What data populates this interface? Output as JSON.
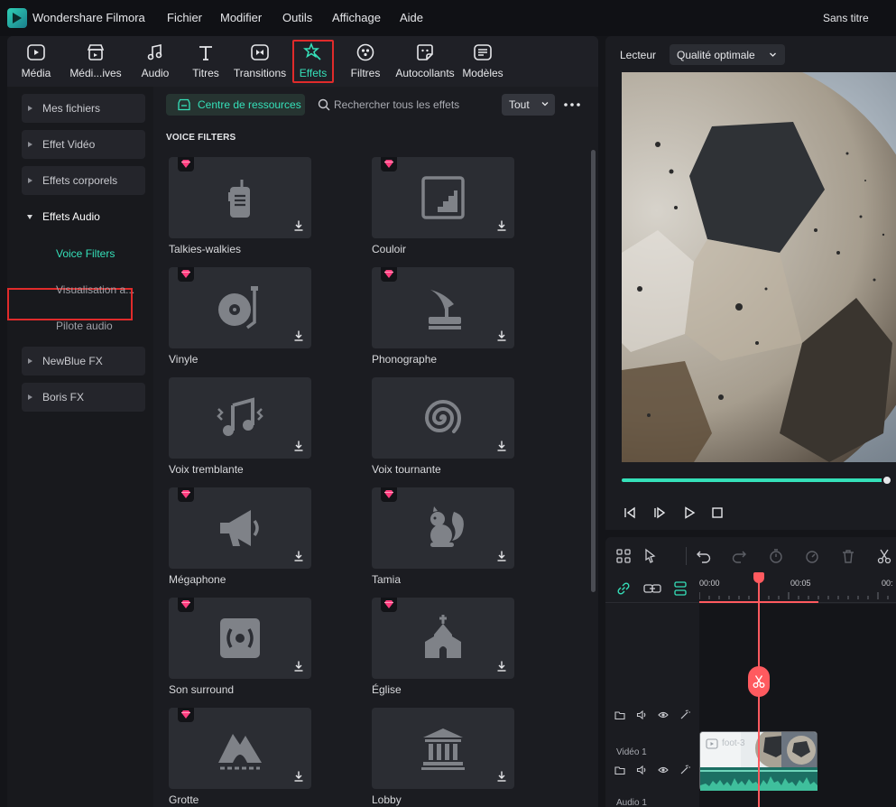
{
  "app": {
    "name": "Wondershare Filmora",
    "doc_title": "Sans titre"
  },
  "menu": [
    "Fichier",
    "Modifier",
    "Outils",
    "Affichage",
    "Aide"
  ],
  "toolbar": {
    "items": [
      {
        "label": "Média",
        "icon": "media-icon"
      },
      {
        "label": "Médi...ives",
        "icon": "stock-media-icon"
      },
      {
        "label": "Audio",
        "icon": "music-note-icon"
      },
      {
        "label": "Titres",
        "icon": "text-icon"
      },
      {
        "label": "Transitions",
        "icon": "transition-icon"
      },
      {
        "label": "Effets",
        "icon": "effects-star-icon",
        "active": true
      },
      {
        "label": "Filtres",
        "icon": "filter-icon"
      },
      {
        "label": "Autocollants",
        "icon": "sticker-icon"
      },
      {
        "label": "Modèles",
        "icon": "template-icon"
      }
    ]
  },
  "sidebar": {
    "categories": [
      {
        "label": "Mes fichiers",
        "expanded": false
      },
      {
        "label": "Effet Vidéo",
        "expanded": false
      },
      {
        "label": "Effets corporels",
        "expanded": false
      },
      {
        "label": "Effets Audio",
        "expanded": true
      },
      {
        "label": "NewBlue FX",
        "expanded": false
      },
      {
        "label": "Boris FX",
        "expanded": false
      }
    ],
    "subitems": [
      {
        "label": "Voice Filters",
        "selected": true
      },
      {
        "label": "Visualisation a...",
        "selected": false
      },
      {
        "label": "Pilote audio",
        "selected": false
      }
    ]
  },
  "content": {
    "resource_button": "Centre de ressources",
    "search_placeholder": "Rechercher tous les effets",
    "filter_value": "Tout",
    "section_title": "VOICE FILTERS",
    "effects": [
      {
        "label": "Talkies-walkies",
        "icon": "walkie-talkie-icon",
        "premium": true
      },
      {
        "label": "Couloir",
        "icon": "stairs-icon",
        "premium": true
      },
      {
        "label": "Vinyle",
        "icon": "turntable-icon",
        "premium": true
      },
      {
        "label": "Phonographe",
        "icon": "phonograph-icon",
        "premium": true
      },
      {
        "label": "Voix tremblante",
        "icon": "trembling-music-icon",
        "premium": false
      },
      {
        "label": "Voix tournante",
        "icon": "spiral-icon",
        "premium": false
      },
      {
        "label": "Mégaphone",
        "icon": "megaphone-icon",
        "premium": true
      },
      {
        "label": "Tamia",
        "icon": "squirrel-icon",
        "premium": true
      },
      {
        "label": "Son surround",
        "icon": "surround-speaker-icon",
        "premium": true
      },
      {
        "label": "Église",
        "icon": "church-icon",
        "premium": true
      },
      {
        "label": "Grotte",
        "icon": "cave-icon",
        "premium": true
      },
      {
        "label": "Lobby",
        "icon": "building-icon",
        "premium": false
      }
    ]
  },
  "player": {
    "label": "Lecteur",
    "quality": "Qualité optimale",
    "progress": 1.0
  },
  "timeline": {
    "timecodes": [
      "00:00",
      "00:05",
      "00:"
    ],
    "video_track": "Vidéo 1",
    "audio_track": "Audio 1",
    "clip_text": "foot-3"
  },
  "colors": {
    "accent": "#35e0b9",
    "highlight": "#e02b2b",
    "playhead": "#ff5a5f",
    "premium_gem": "#ff3d7f"
  }
}
